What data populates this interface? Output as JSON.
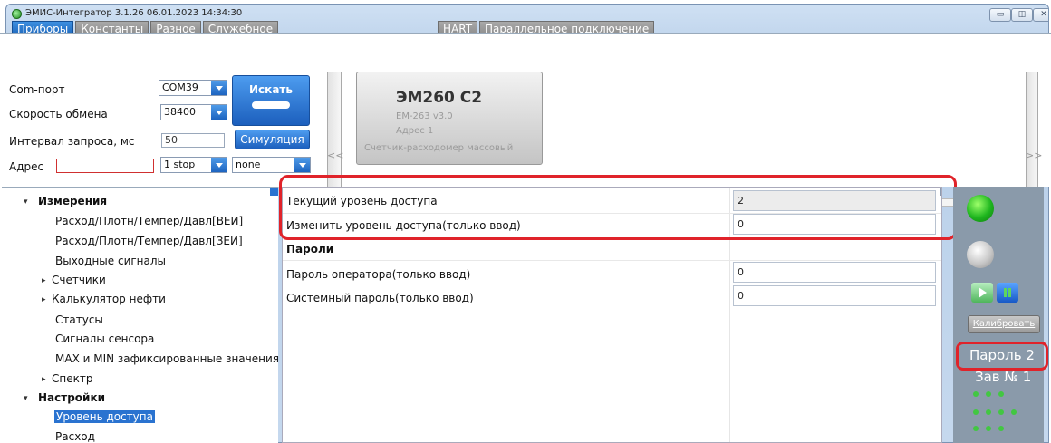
{
  "window": {
    "title": "ЭМИС-Интегратор 3.1.26 06.01.2023 14:34:30",
    "controls": {
      "minimize": "▭",
      "maximize": "◫",
      "close": "✕"
    }
  },
  "menu": {
    "left_tabs": [
      "Приборы",
      "Константы",
      "Разное",
      "Служебное"
    ],
    "right_tabs": [
      "HART",
      "Параллельное подключение"
    ],
    "active": "Приборы"
  },
  "connection": {
    "com_port_label": "Com-порт",
    "com_port_value": "COM39",
    "baud_label": "Скорость обмена",
    "baud_value": "38400",
    "interval_label": "Интервал запроса, мс",
    "interval_value": "50",
    "address_label": "Адрес",
    "address_value": "",
    "stop_bits_value": "1 stop",
    "parity_value": "none",
    "search_button": "Искать",
    "simulation_button": "Симуляция"
  },
  "device_strip": {
    "scroll_left": "<<",
    "scroll_right": ">>",
    "device": {
      "name": "ЭМ260 С2",
      "model": "EM-263 v3.0",
      "address": "Адрес 1",
      "description": "Счетчик-расходомер массовый"
    }
  },
  "tree": {
    "groups": [
      {
        "label": "Измерения",
        "children": [
          "Расход/Плотн/Темпер/Давл[ВЕИ]",
          "Расход/Плотн/Темпер/Давл[ЗЕИ]",
          "Выходные сигналы",
          "Счетчики",
          "Калькулятор нефти",
          "Статусы",
          "Сигналы сенсора",
          "MAX и MIN зафиксированные значения",
          "Спектр"
        ]
      },
      {
        "label": "Настройки",
        "children": [
          "Уровень доступа",
          "Расход"
        ]
      }
    ],
    "selected": "Уровень доступа"
  },
  "properties": {
    "rows": [
      {
        "label": "Текущий уровень доступа",
        "value": "2",
        "readonly": true
      },
      {
        "label": "Изменить уровень доступа(только ввод)",
        "value": "0",
        "readonly": false
      }
    ],
    "section_title": "Пароли",
    "password_rows": [
      {
        "label": "Пароль оператора(только ввод)",
        "value": "0"
      },
      {
        "label": "Системный пароль(только ввод)",
        "value": "0"
      }
    ]
  },
  "status_panel": {
    "calibrate_button": "Калибровать",
    "password_status": "Пароль 2",
    "serial_status": "Зав № 1",
    "colors": {
      "led_active": "#1fb61f",
      "led_inactive": "#c8c8c8",
      "highlight": "#e0232a"
    }
  }
}
